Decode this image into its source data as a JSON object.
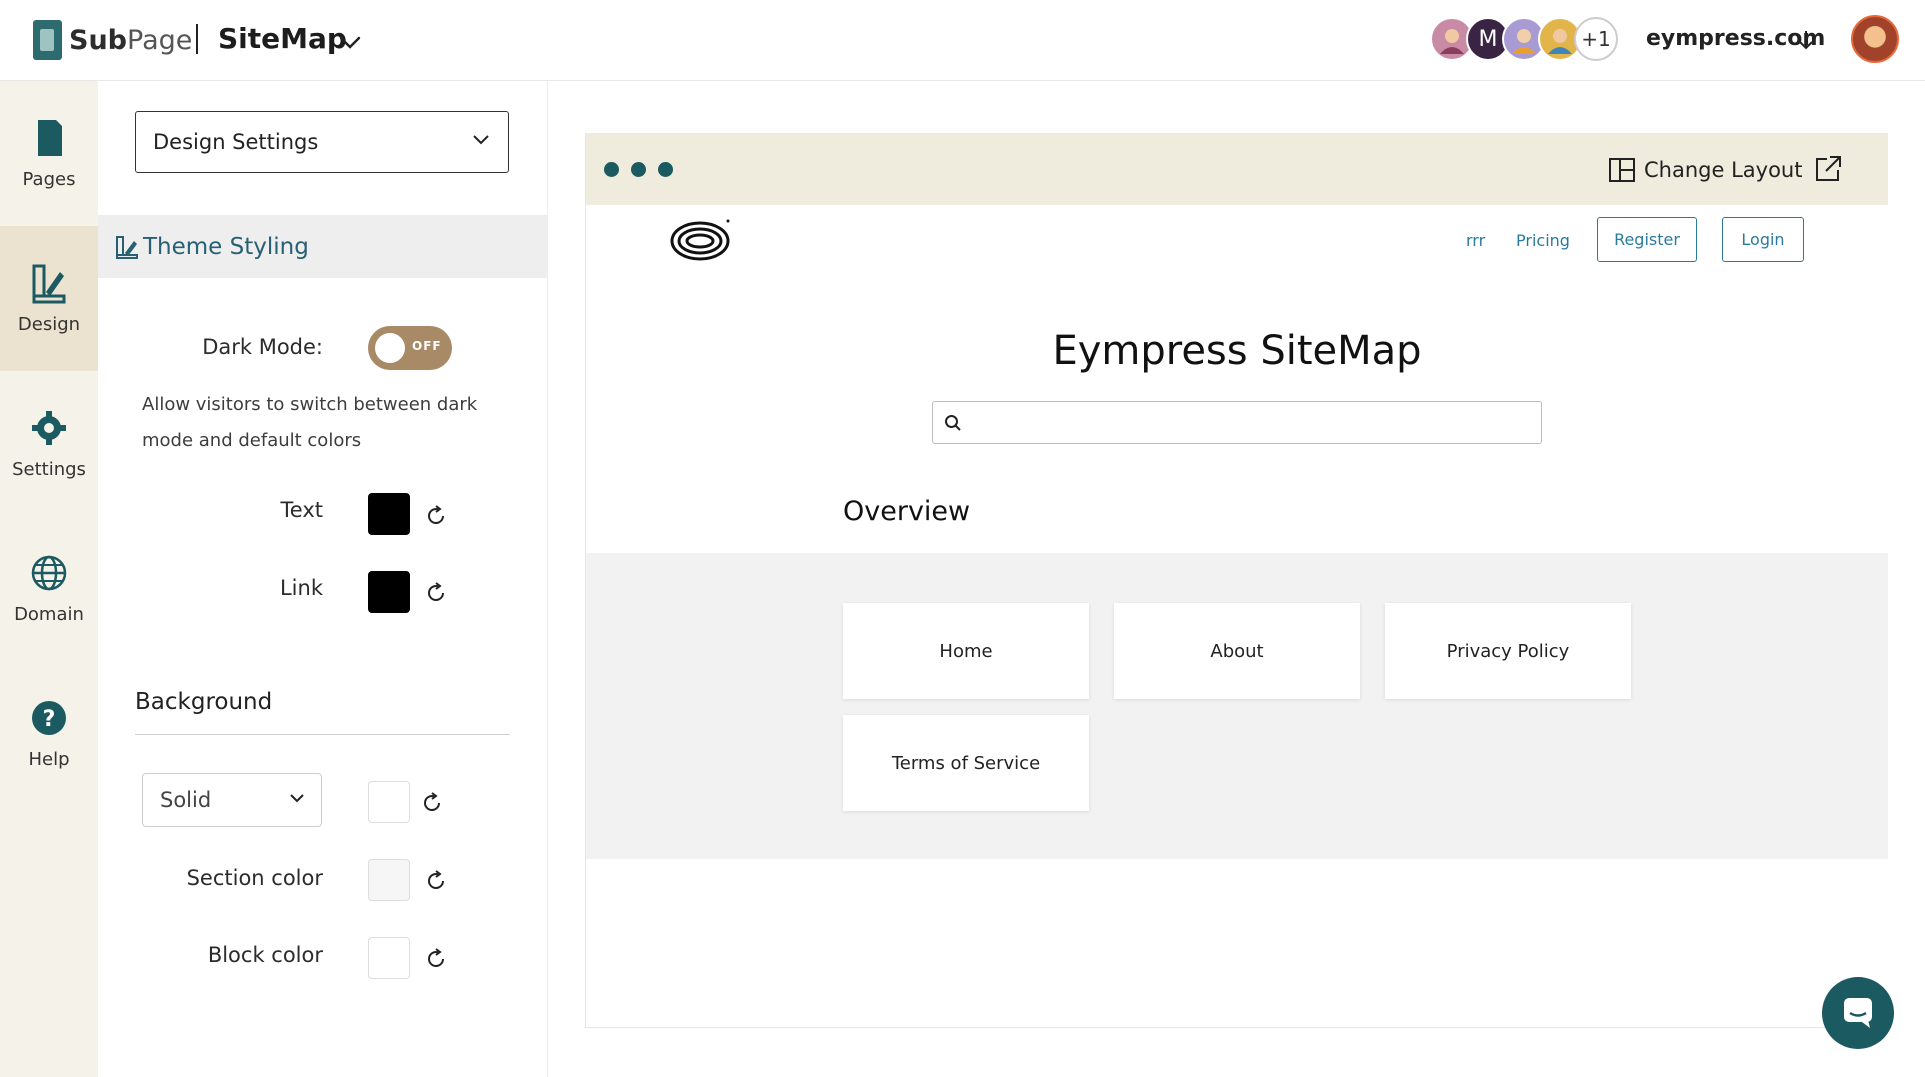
{
  "header": {
    "brand_sub": "Sub",
    "brand_page": "Page",
    "site_title": "SiteMap",
    "avatars_more": "+1",
    "avatar_m": "M",
    "domain": "eympress.com"
  },
  "rail": {
    "items": [
      {
        "label": "Pages",
        "icon": "page-icon"
      },
      {
        "label": "Design",
        "icon": "design-icon",
        "active": true
      },
      {
        "label": "Settings",
        "icon": "gear-icon"
      },
      {
        "label": "Domain",
        "icon": "globe-icon"
      },
      {
        "label": "Help",
        "icon": "help-icon"
      }
    ]
  },
  "panel": {
    "select_value": "Design Settings",
    "section_title": "Theme Styling",
    "dark_mode_label": "Dark Mode:",
    "dark_mode_state": "OFF",
    "dark_mode_help": "Allow visitors to switch between dark mode and default colors",
    "text_label": "Text",
    "text_color": "#000000",
    "link_label": "Link",
    "link_color": "#000000",
    "background_title": "Background",
    "background_type": "Solid",
    "background_color": "#ffffff",
    "section_color_label": "Section color",
    "section_color": "#f6f6f6",
    "block_color_label": "Block color",
    "block_color": "#ffffff"
  },
  "preview": {
    "change_layout": "Change Layout",
    "nav": {
      "link1": "rrr",
      "link2": "Pricing",
      "register": "Register",
      "login": "Login"
    },
    "title": "Eympress SiteMap",
    "overview": "Overview",
    "cards": [
      "Home",
      "About",
      "Privacy Policy",
      "Terms of Service"
    ]
  },
  "colors": {
    "accent": "#1b5a60",
    "link": "#2a7b9b",
    "toggle": "#a98a66"
  }
}
